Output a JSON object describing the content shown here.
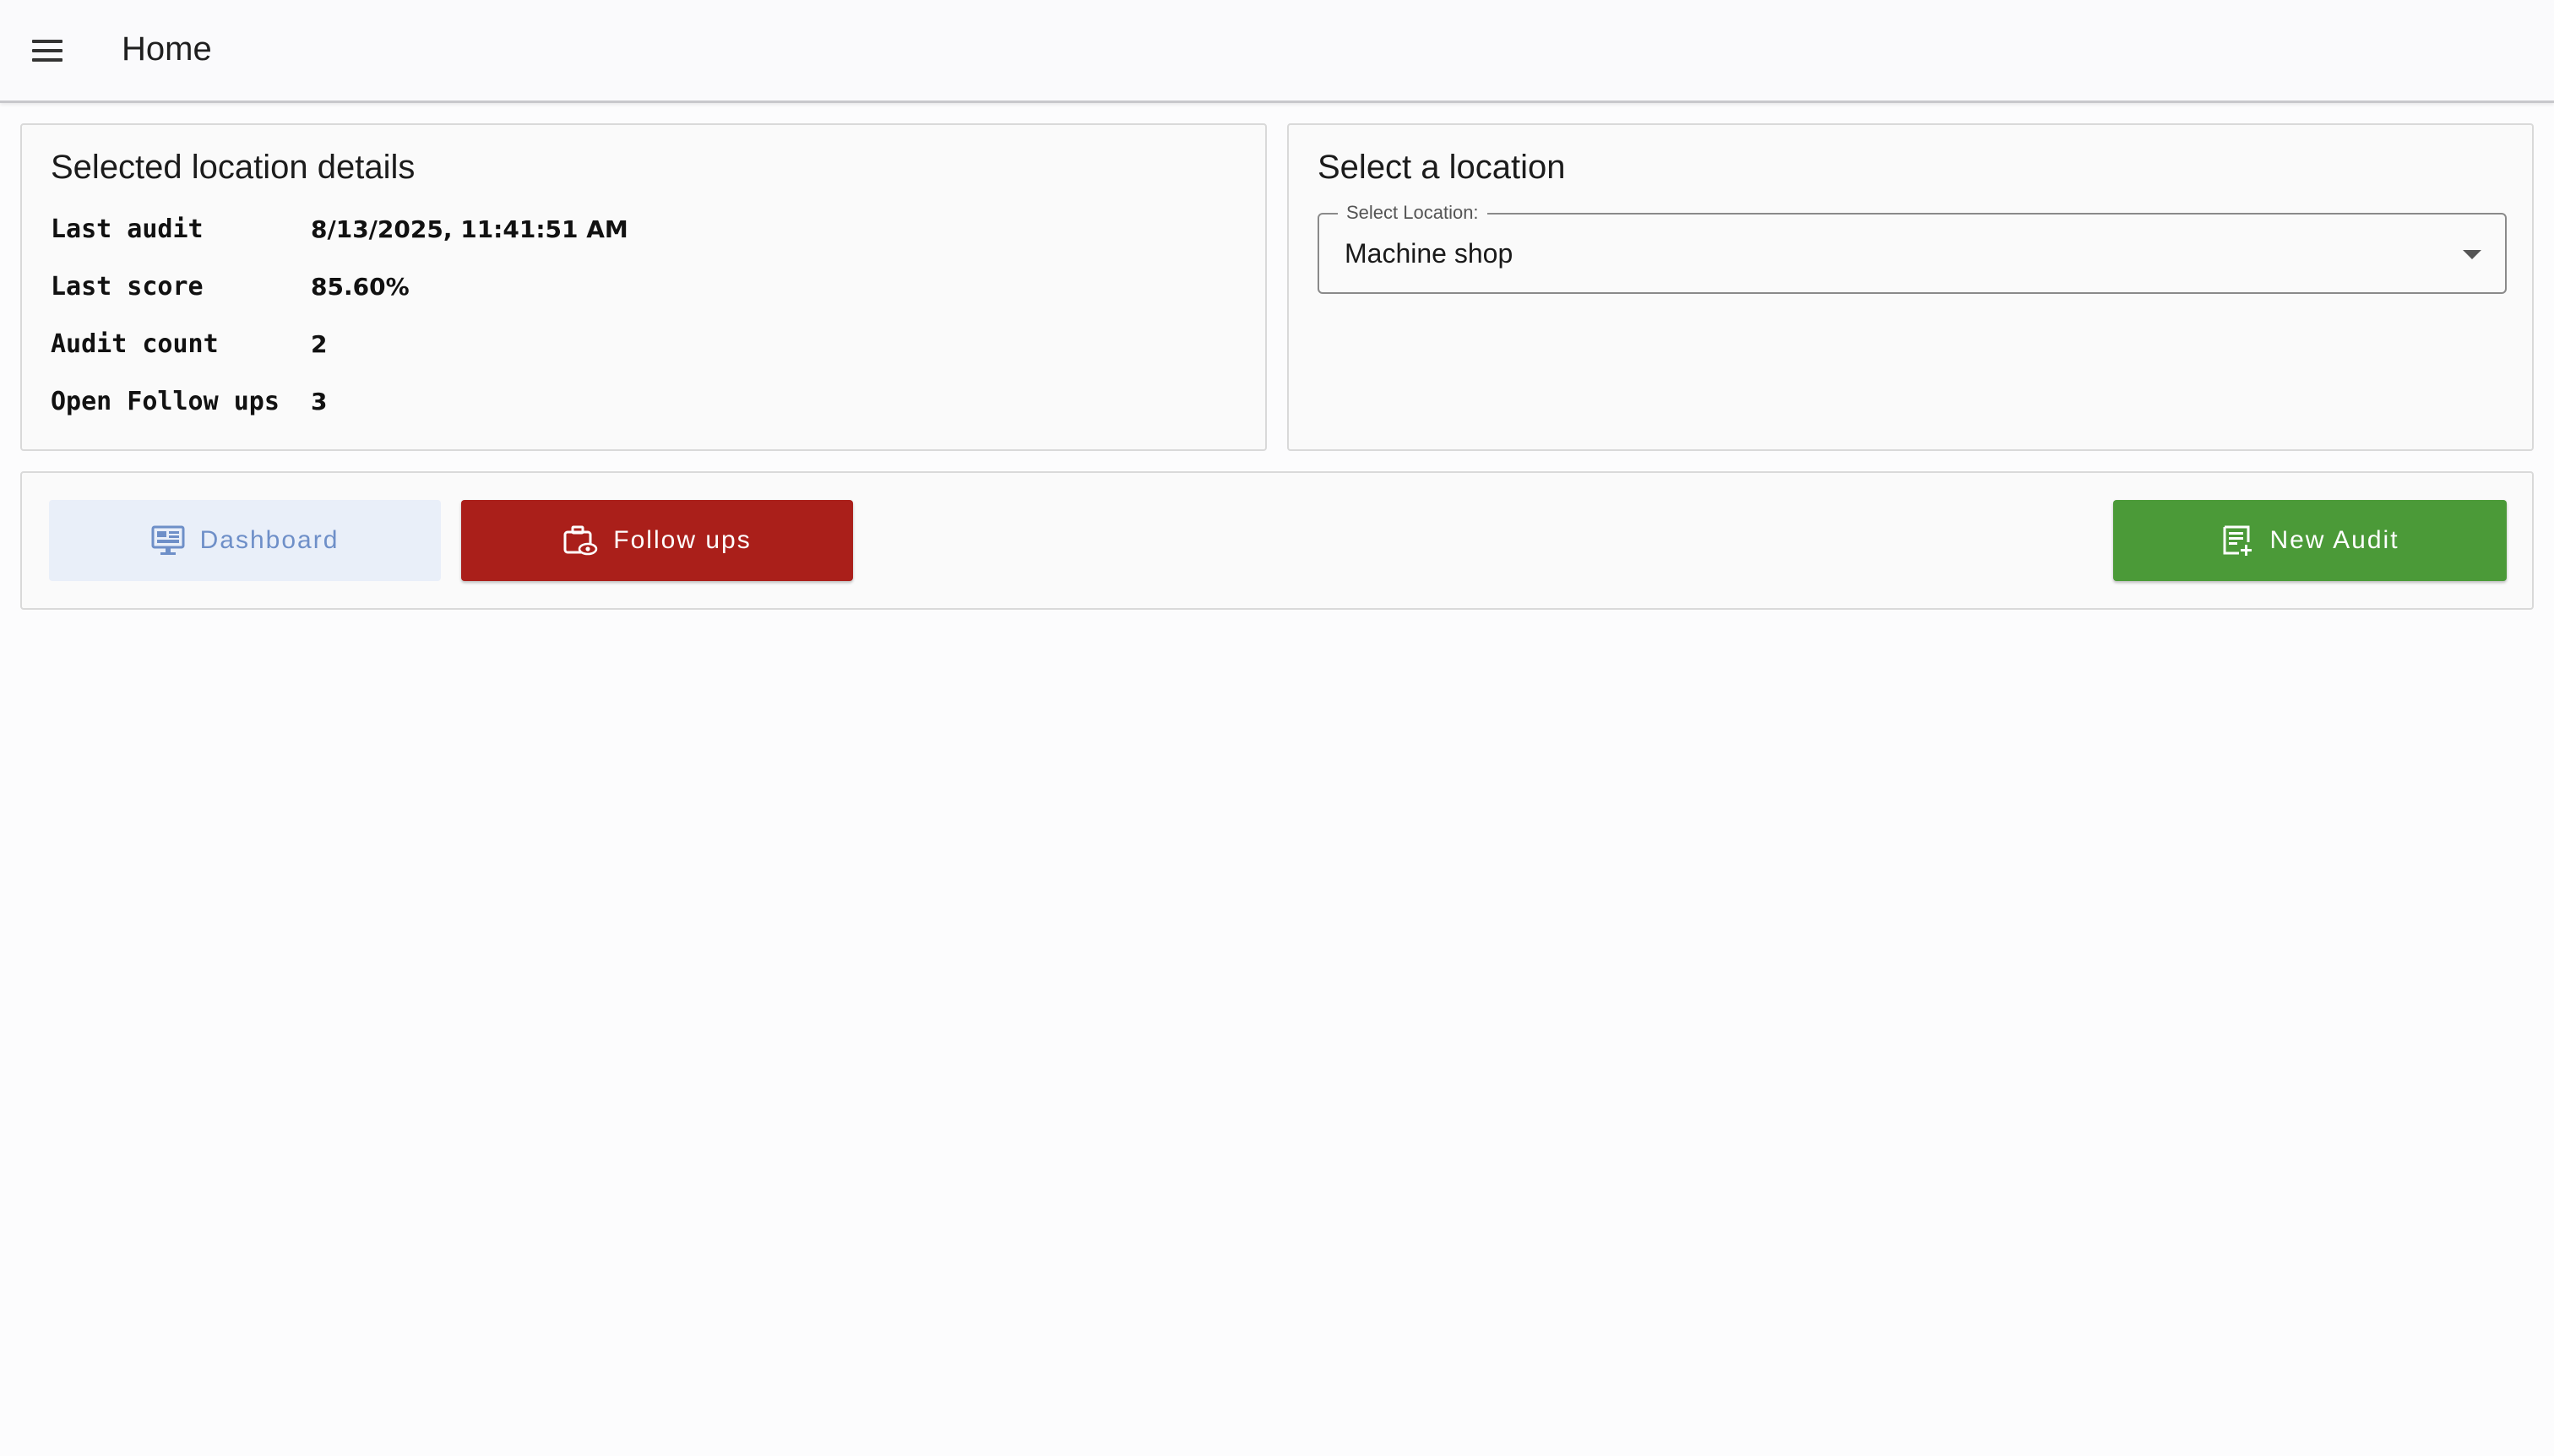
{
  "header": {
    "menu_icon": "hamburger-menu-icon",
    "title": "Home"
  },
  "details": {
    "title": "Selected location details",
    "rows": [
      {
        "label": "Last audit",
        "value": "8/13/2025, 11:41:51 AM"
      },
      {
        "label": "Last score",
        "value": "85.60%"
      },
      {
        "label": "Audit count",
        "value": "2"
      },
      {
        "label": "Open Follow ups",
        "value": "3"
      }
    ]
  },
  "location": {
    "title": "Select a location",
    "select_label": "Select Location:",
    "selected_value": "Machine shop"
  },
  "actions": {
    "dashboard": {
      "label": "Dashboard",
      "icon": "dashboard-monitor-icon",
      "color": "#e9eff9"
    },
    "followups": {
      "label": "Follow ups",
      "icon": "briefcase-eye-icon",
      "color": "#aa1f1a"
    },
    "new_audit": {
      "label": "New Audit",
      "icon": "note-add-icon",
      "color": "#4b9a38"
    }
  }
}
